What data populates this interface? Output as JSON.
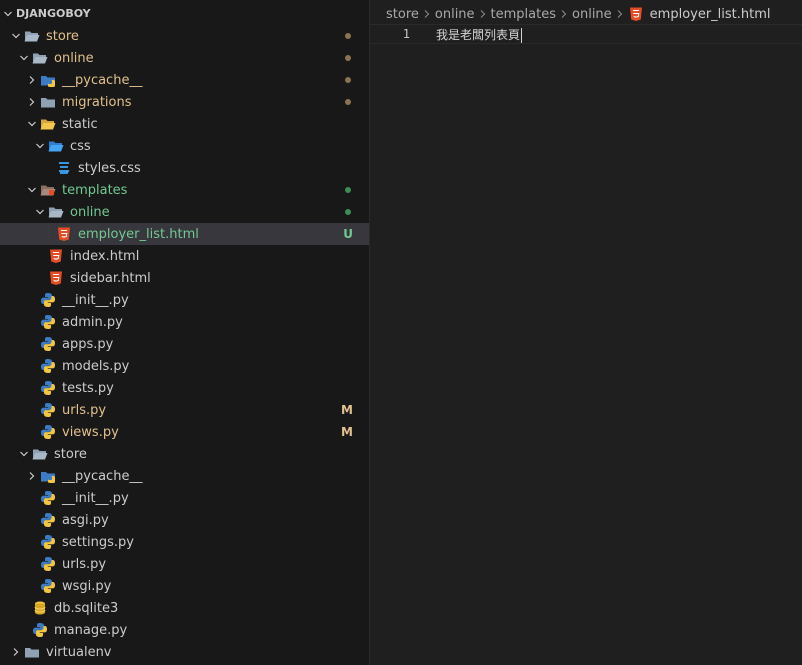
{
  "explorer": {
    "root_label": "DJANGOBOY",
    "items": [
      {
        "label": "store",
        "type": "folder",
        "icon": "folder-open-icon",
        "open": true,
        "depth": 0,
        "status": "mod-dot"
      },
      {
        "label": "online",
        "type": "folder",
        "icon": "folder-open-icon",
        "open": true,
        "depth": 1,
        "status": "mod-dot"
      },
      {
        "label": "__pycache__",
        "type": "folder",
        "icon": "python-folder-icon",
        "open": false,
        "depth": 2,
        "status": "mod-dot"
      },
      {
        "label": "migrations",
        "type": "folder",
        "icon": "folder-icon",
        "open": false,
        "depth": 2,
        "status": "mod-dot"
      },
      {
        "label": "static",
        "type": "folder",
        "icon": "folder-open-yellow-icon",
        "open": true,
        "depth": 2,
        "status": ""
      },
      {
        "label": "css",
        "type": "folder",
        "icon": "css-folder-icon",
        "open": true,
        "depth": 3,
        "status": ""
      },
      {
        "label": "styles.css",
        "type": "file",
        "icon": "css-file-icon",
        "depth": 4,
        "status": ""
      },
      {
        "label": "templates",
        "type": "folder",
        "icon": "templates-folder-icon",
        "open": true,
        "depth": 2,
        "status": "new-dot"
      },
      {
        "label": "online",
        "type": "folder",
        "icon": "folder-open-icon",
        "open": true,
        "depth": 3,
        "status": "new-dot"
      },
      {
        "label": "employer_list.html",
        "type": "file",
        "icon": "html-file-icon",
        "depth": 4,
        "status": "U",
        "selected": true
      },
      {
        "label": "index.html",
        "type": "file",
        "icon": "html-file-icon",
        "depth": 3,
        "status": ""
      },
      {
        "label": "sidebar.html",
        "type": "file",
        "icon": "html-file-icon",
        "depth": 3,
        "status": ""
      },
      {
        "label": "__init__.py",
        "type": "file",
        "icon": "python-icon",
        "depth": 2,
        "status": ""
      },
      {
        "label": "admin.py",
        "type": "file",
        "icon": "python-icon",
        "depth": 2,
        "status": ""
      },
      {
        "label": "apps.py",
        "type": "file",
        "icon": "python-icon",
        "depth": 2,
        "status": ""
      },
      {
        "label": "models.py",
        "type": "file",
        "icon": "python-icon",
        "depth": 2,
        "status": ""
      },
      {
        "label": "tests.py",
        "type": "file",
        "icon": "python-icon",
        "depth": 2,
        "status": ""
      },
      {
        "label": "urls.py",
        "type": "file",
        "icon": "python-icon",
        "depth": 2,
        "status": "M"
      },
      {
        "label": "views.py",
        "type": "file",
        "icon": "python-icon",
        "depth": 2,
        "status": "M"
      },
      {
        "label": "store",
        "type": "folder",
        "icon": "folder-open-icon",
        "open": true,
        "depth": 1,
        "status": ""
      },
      {
        "label": "__pycache__",
        "type": "folder",
        "icon": "python-folder-icon",
        "open": false,
        "depth": 2,
        "status": ""
      },
      {
        "label": "__init__.py",
        "type": "file",
        "icon": "python-icon",
        "depth": 2,
        "status": ""
      },
      {
        "label": "asgi.py",
        "type": "file",
        "icon": "python-icon",
        "depth": 2,
        "status": ""
      },
      {
        "label": "settings.py",
        "type": "file",
        "icon": "python-icon",
        "depth": 2,
        "status": ""
      },
      {
        "label": "urls.py",
        "type": "file",
        "icon": "python-icon",
        "depth": 2,
        "status": ""
      },
      {
        "label": "wsgi.py",
        "type": "file",
        "icon": "python-icon",
        "depth": 2,
        "status": ""
      },
      {
        "label": "db.sqlite3",
        "type": "file",
        "icon": "database-icon",
        "depth": 1,
        "status": ""
      },
      {
        "label": "manage.py",
        "type": "file",
        "icon": "python-icon",
        "depth": 1,
        "status": ""
      },
      {
        "label": "virtualenv",
        "type": "folder",
        "icon": "folder-icon",
        "open": false,
        "depth": 0,
        "status": ""
      }
    ]
  },
  "editor": {
    "breadcrumb": [
      "store",
      "online",
      "templates",
      "online",
      "employer_list.html"
    ],
    "lines": [
      {
        "number": "1",
        "text": "我是老闆列表頁"
      }
    ]
  },
  "colors": {
    "modified": "#e2c08d",
    "untracked": "#73c991",
    "html_icon": "#e44d26",
    "css_icon": "#42a5f5",
    "folder": "#8fa1b3"
  }
}
